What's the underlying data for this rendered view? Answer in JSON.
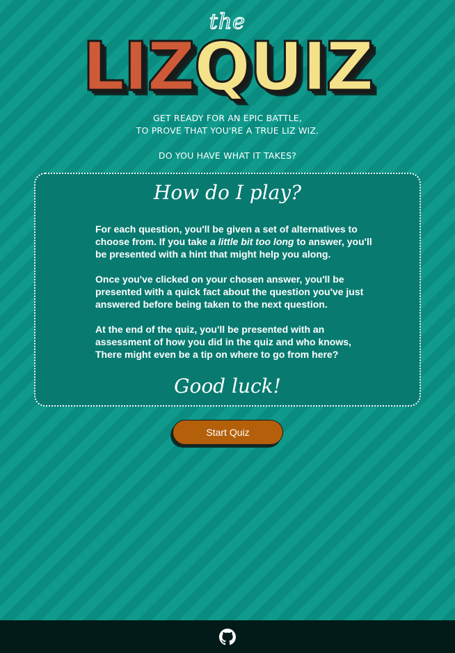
{
  "logo": {
    "prefix": "the",
    "part1": "LIZ",
    "part2": "QUIZ"
  },
  "tagline": {
    "line1": "GET READY FOR AN EPIC BATTLE,",
    "line2": "TO PROVE THAT YOU'RE A TRUE LIZ WIZ.",
    "question": "DO YOU HAVE WHAT IT TAKES?"
  },
  "instructions": {
    "title": "How do I play?",
    "p1_before": "For each question, you'll be given a set of alternatives to choose from. If you take ",
    "p1_em": "a little bit too long",
    "p1_after": " to answer, you'll be presented with a hint that might help you along.",
    "p2": "Once you've clicked on your chosen answer, you'll be presented with a quick fact about the question you've just answered before being taken to the next question.",
    "p3": "At the end of the quiz, you'll be presented with an assessment of how you did in the quiz and who knows, There might even be a tip on where to go from here?",
    "signoff": "Good luck!"
  },
  "actions": {
    "start_label": "Start Quiz"
  },
  "footer": {
    "icon": "github-icon"
  },
  "colors": {
    "background": "#0d9488",
    "card": "#087a70",
    "button": "#b45f0a",
    "logo_red": "#cf5a37",
    "logo_yellow": "#f4e28b",
    "footer": "#021b18"
  }
}
